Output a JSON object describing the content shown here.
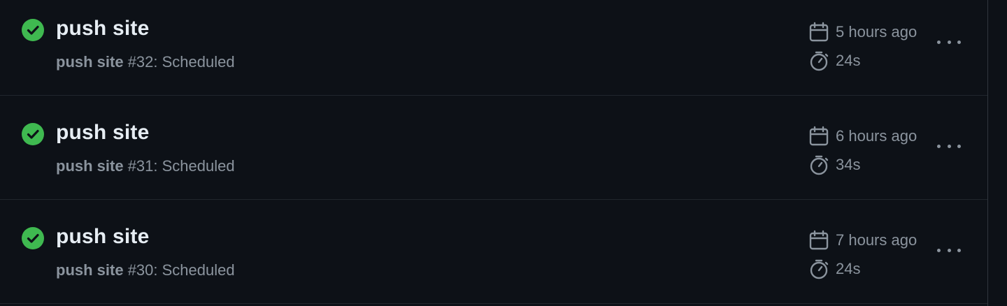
{
  "runs": [
    {
      "title": "push site",
      "workflow": "push site",
      "run_suffix": " #32: Scheduled",
      "started": "5 hours ago",
      "duration": "24s",
      "status": "success"
    },
    {
      "title": "push site",
      "workflow": "push site",
      "run_suffix": " #31: Scheduled",
      "started": "6 hours ago",
      "duration": "34s",
      "status": "success"
    },
    {
      "title": "push site",
      "workflow": "push site",
      "run_suffix": " #30: Scheduled",
      "started": "7 hours ago",
      "duration": "24s",
      "status": "success"
    }
  ],
  "colors": {
    "background": "#0d1117",
    "success": "#3fb950",
    "title_text": "#e6edf3",
    "muted_text": "#8b949e"
  },
  "icons": {
    "status": "check-circle-icon",
    "date": "calendar-icon",
    "duration": "stopwatch-icon",
    "menu": "kebab-horizontal-icon"
  }
}
